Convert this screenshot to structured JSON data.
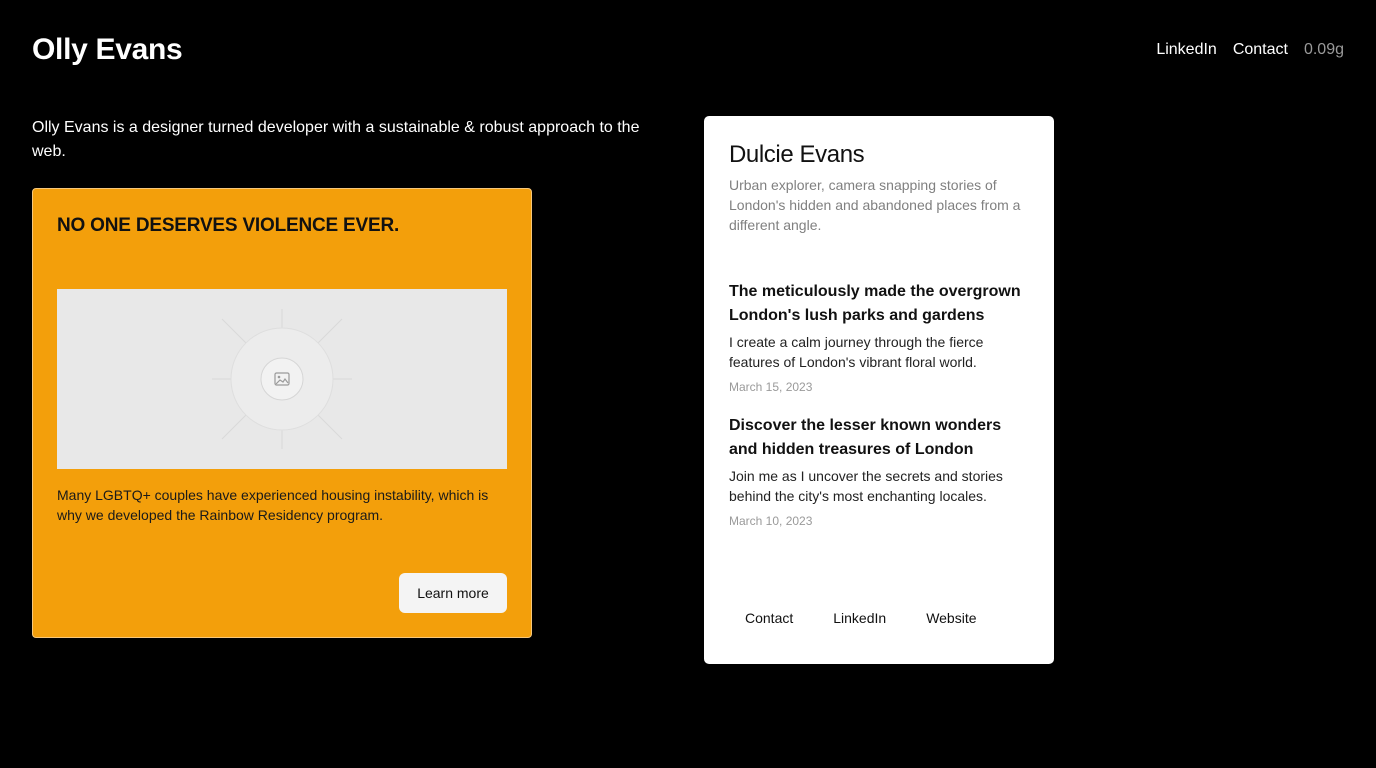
{
  "header": {
    "title": "Olly Evans",
    "nav": {
      "linkedin": "LinkedIn",
      "contact": "Contact",
      "weight": "0.09g"
    }
  },
  "intro": "Olly Evans is a designer turned developer with a sustainable & robust approach to the web.",
  "promo": {
    "title": "NO ONE DESERVES VIOLENCE EVER.",
    "image_icon": "image-placeholder-icon",
    "text": "Many LGBTQ+ couples have experienced housing instability, which is why we developed the Rainbow Residency program.",
    "button_label": "Learn more",
    "background_color": "#f39f0b"
  },
  "profile": {
    "name": "Dulcie Evans",
    "bio": "Urban explorer, camera snapping stories of London's hidden and abandoned places from a different angle.",
    "posts": [
      {
        "title": "The meticulously made the overgrown London's lush parks and gardens",
        "desc": "I create a calm journey through the fierce features of London's vibrant floral world.",
        "date": "March 15, 2023"
      },
      {
        "title": "Discover the lesser known wonders and hidden treasures of London",
        "desc": "Join me as I uncover the secrets and stories behind the city's most enchanting locales.",
        "date": "March 10, 2023"
      }
    ],
    "links": {
      "contact": "Contact",
      "linkedin": "LinkedIn",
      "website": "Website"
    }
  }
}
